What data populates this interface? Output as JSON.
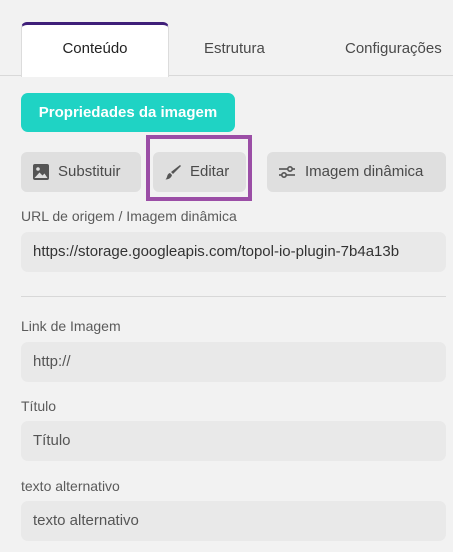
{
  "tabs": [
    {
      "label": "Conteúdo",
      "active": true
    },
    {
      "label": "Estrutura",
      "active": false
    },
    {
      "label": "Configurações",
      "active": false
    }
  ],
  "image_properties_button": "Propriedades da imagem",
  "toolbar": {
    "replace": {
      "label": "Substituir",
      "icon": "image-icon"
    },
    "edit": {
      "label": "Editar",
      "icon": "brush-icon",
      "highlighted": true
    },
    "dynamic": {
      "label": "Imagem dinâmica",
      "icon": "sliders-icon"
    }
  },
  "source_url": {
    "label": "URL de origem / Imagem dinâmica",
    "value": "https://storage.googleapis.com/topol-io-plugin-7b4a13b"
  },
  "image_link": {
    "label": "Link de Imagem",
    "placeholder": "http://"
  },
  "title_field": {
    "label": "Título",
    "placeholder": "Título"
  },
  "alt_text": {
    "label": "texto alternativo",
    "placeholder": "texto alternativo"
  },
  "colors": {
    "accent": "#1fd3c4",
    "active_tab_border": "#3f1f79",
    "highlight_box": "#9b4ea6"
  }
}
